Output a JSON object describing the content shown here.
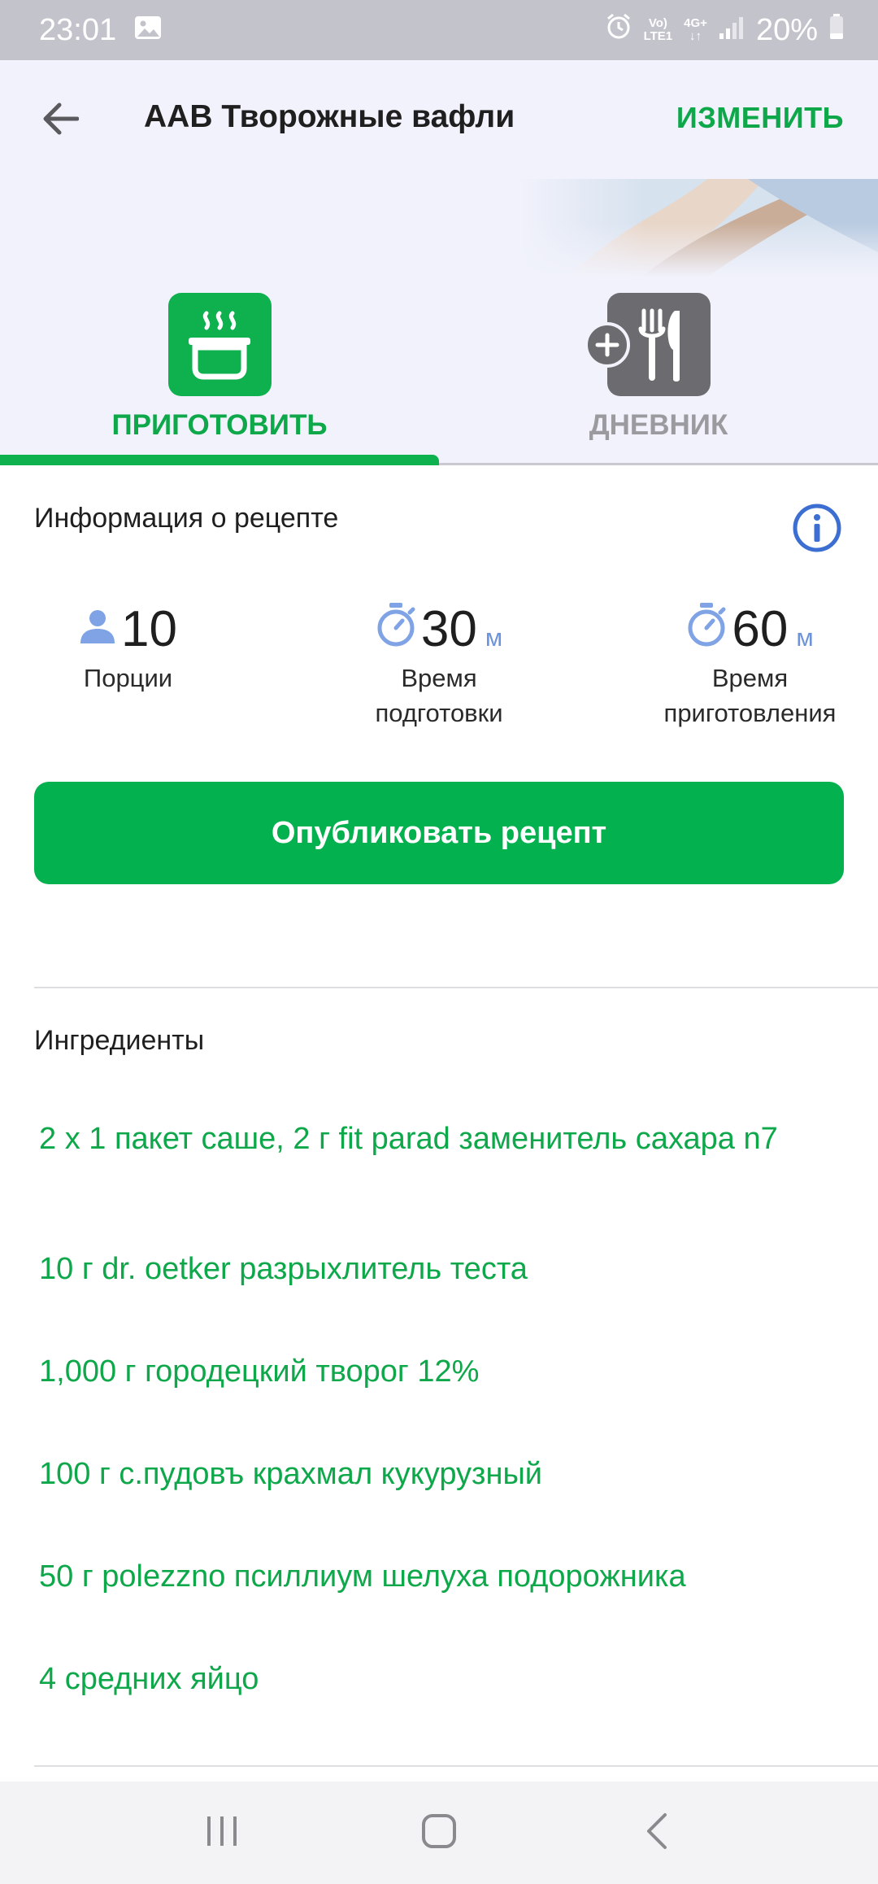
{
  "status_bar": {
    "time": "23:01",
    "network_top": "Vo)",
    "network_bottom": "LTE1",
    "net_4g": "4G+",
    "battery": "20%",
    "icons": [
      "image-icon",
      "alarm-icon",
      "signal-icon",
      "battery-icon"
    ]
  },
  "header": {
    "title": "ААВ Творожные вафли",
    "edit_label": "ИЗМЕНИТЬ"
  },
  "tabs": [
    {
      "label": "ПРИГОТОВИТЬ",
      "icon": "cooking-pot-icon",
      "active": true
    },
    {
      "label": "ДНЕВНИК",
      "icon": "add-cutlery-icon",
      "active": false
    }
  ],
  "recipe_info": {
    "title": "Информация о рецепте",
    "servings": {
      "value": "10",
      "label": "Порции"
    },
    "prep_time": {
      "value": "30",
      "unit": "м",
      "label_line1": "Время",
      "label_line2": "подготовки"
    },
    "cook_time": {
      "value": "60",
      "unit": "м",
      "label_line1": "Время",
      "label_line2": "приготовления"
    }
  },
  "publish_label": "Опубликовать рецепт",
  "ingredients": {
    "title": "Ингредиенты",
    "items": [
      "2 x 1 пакет саше, 2 г fit parad заменитель сахара n7",
      "10 г dr. oetker разрыхлитель теста",
      "1,000 г городецкий  творог 12%",
      "100 г с.пудовъ крахмал кукурузный",
      "50 г polezzno псиллиум шелуха подорожника",
      "4 средних  яйцо"
    ]
  },
  "colors": {
    "accent": "#0fb14f",
    "info_blue": "#3c6fd1",
    "muted": "#6c6c70"
  }
}
